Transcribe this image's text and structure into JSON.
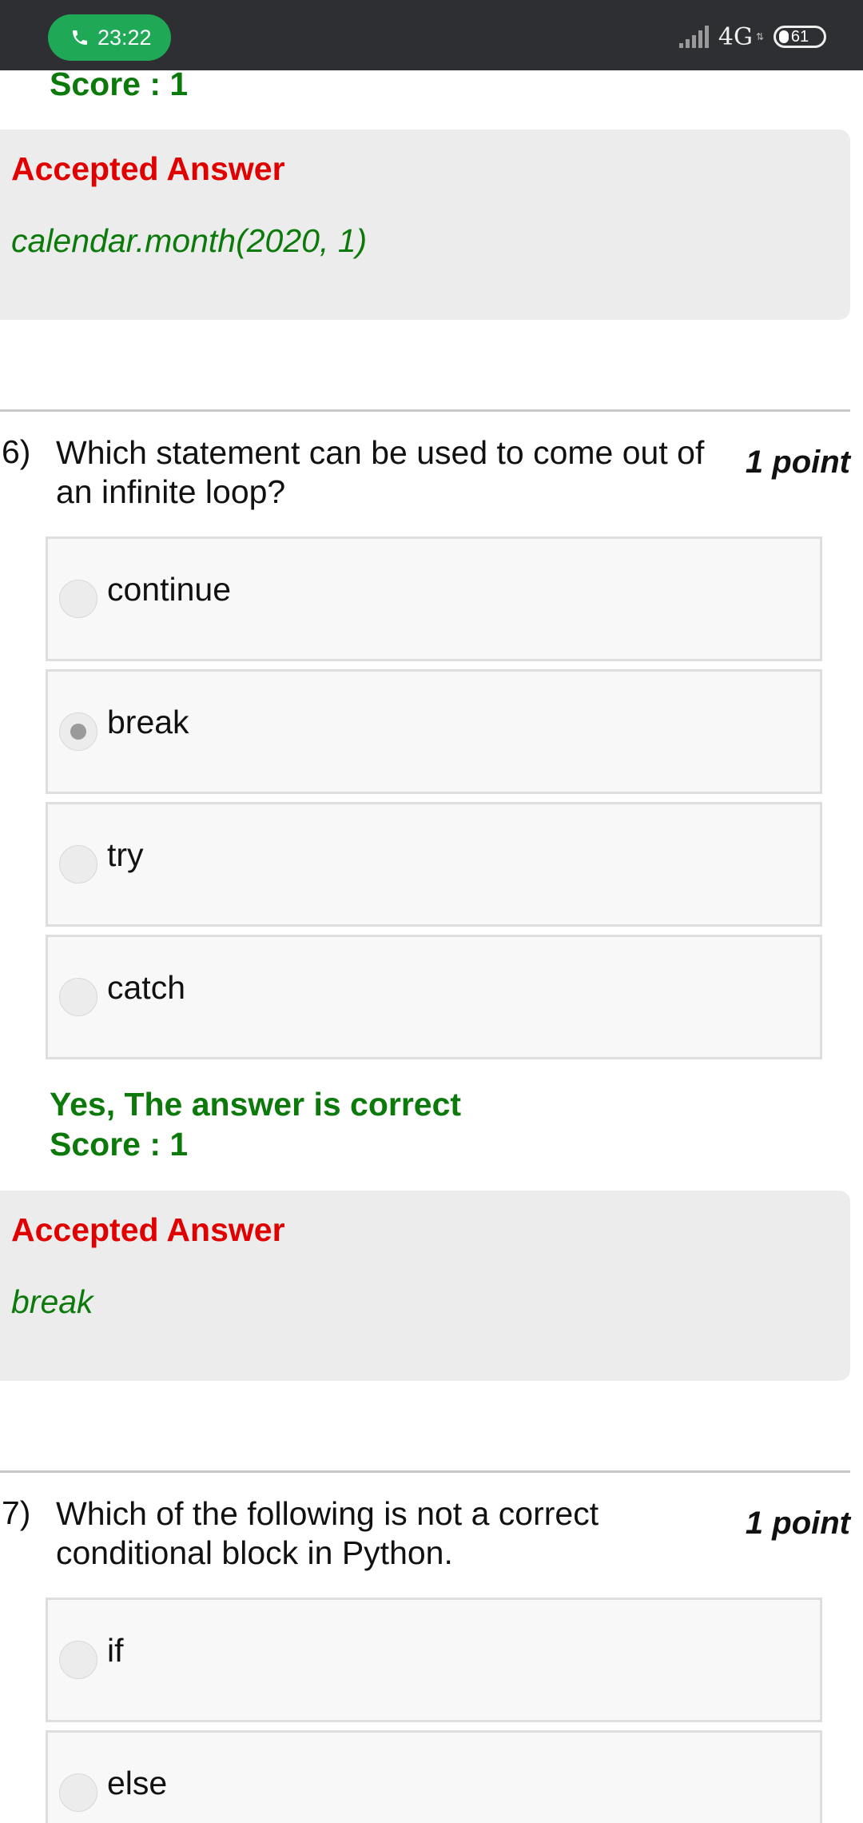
{
  "status_bar": {
    "call_time": "23:22",
    "network": "4G",
    "battery": "61"
  },
  "prev_question": {
    "score": "Score : 1",
    "accepted_title": "Accepted Answer",
    "accepted_answer": "calendar.month(2020, 1)"
  },
  "q6": {
    "number": "6)",
    "text": "Which statement can be used to come out of an infinite loop?",
    "points": "1 point",
    "options": [
      "continue",
      "break",
      "try",
      "catch"
    ],
    "selected_option": "break",
    "feedback": "Yes, The answer is correct",
    "score": "Score : 1",
    "accepted_title": "Accepted Answer",
    "accepted_answer": "break"
  },
  "q7": {
    "number": "7)",
    "text": "Which of the following is not a correct conditional block in Python.",
    "points": "1 point",
    "options": [
      "if",
      "else"
    ]
  },
  "colors": {
    "correct_green": "#0b7a0b",
    "accepted_red": "#e00000",
    "call_pill_green": "#1fa855",
    "status_bar_bg": "#2d2f33"
  }
}
